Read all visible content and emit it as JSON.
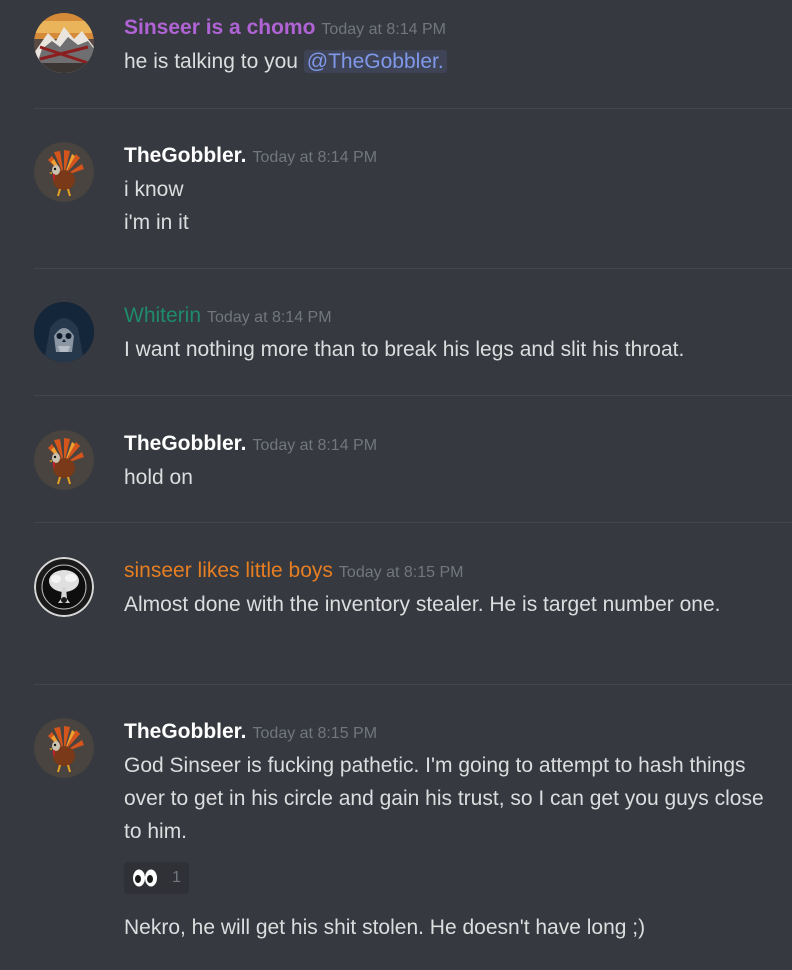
{
  "colors": {
    "background": "#36393f",
    "divider": "#42454a",
    "text": "#dcddde",
    "timestamp": "#72767d",
    "mention": "#7f98ea"
  },
  "messages": [
    {
      "author": "Sinseer is a chomo",
      "author_color": "#b063d4",
      "avatar": "mountain-sunset-avatar",
      "time": "Today at 8:14 PM",
      "text_before": "he is talking to you ",
      "mention": "@TheGobbler."
    },
    {
      "author": "TheGobbler.",
      "author_color": "#ffffff",
      "avatar": "turkey-avatar",
      "time": "Today at 8:14 PM",
      "lines": [
        "i know",
        "i'm in it"
      ]
    },
    {
      "author": "Whiterin",
      "author_color": "#1f8b6a",
      "avatar": "hooded-skull-avatar",
      "time": "Today at 8:14 PM",
      "lines": [
        "I want nothing more than to break his legs and slit his throat."
      ]
    },
    {
      "author": "TheGobbler.",
      "author_color": "#ffffff",
      "avatar": "turkey-avatar",
      "time": "Today at 8:14 PM",
      "lines": [
        "hold on"
      ]
    },
    {
      "author": "sinseer likes little boys",
      "author_color": "#e67e22",
      "avatar": "tree-emblem-avatar",
      "time": "Today at 8:15 PM",
      "lines": [
        "Almost done with the inventory stealer. He is target number one."
      ]
    },
    {
      "author": "TheGobbler.",
      "author_color": "#ffffff",
      "avatar": "turkey-avatar",
      "time": "Today at 8:15 PM",
      "lines": [
        "God Sinseer is fucking pathetic. I'm going to attempt to hash things over to get in his circle and gain his trust, so I can get you guys close to him.",
        "Nekro, he will get his shit stolen. He doesn't have long ;)"
      ],
      "reaction": {
        "emoji": "eyes-emoji",
        "count": "1"
      }
    }
  ]
}
